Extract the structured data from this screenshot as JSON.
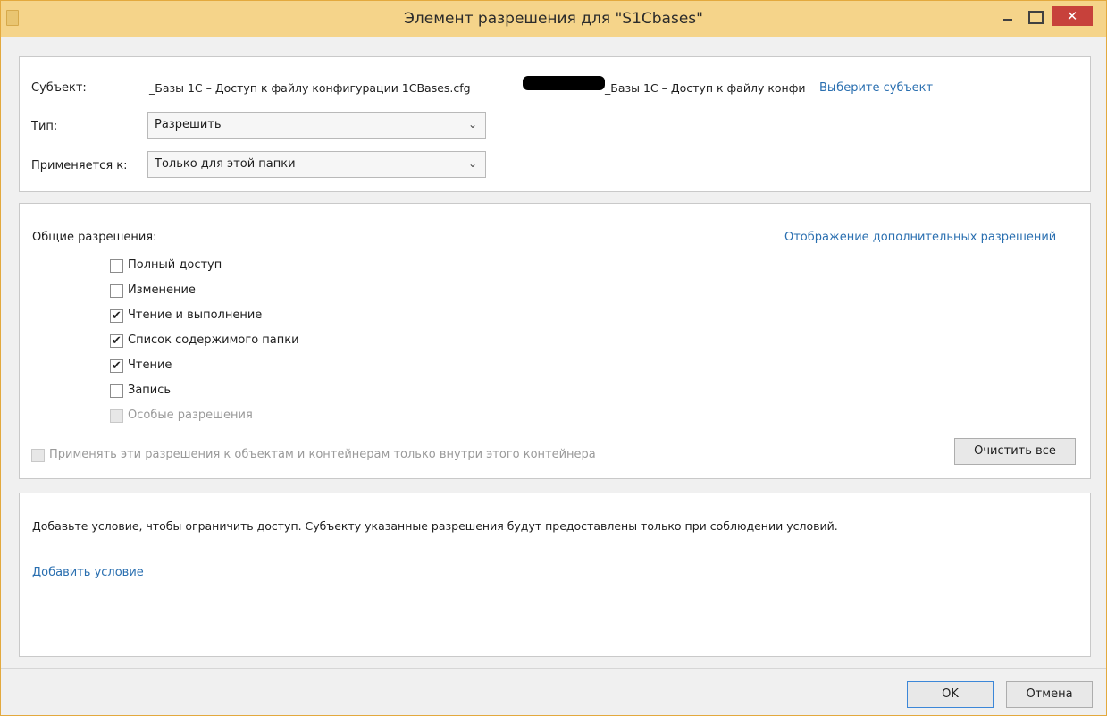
{
  "window": {
    "title": "Элемент разрешения для \"S1Cbases\"",
    "close_glyph": "✕"
  },
  "principal": {
    "label": "Субъект:",
    "value_left": "_Базы 1С – Доступ к файлу конфигурации 1CBases.cfg",
    "value_right": "_Базы 1С – Доступ к файлу конфи",
    "select_link": "Выберите субъект"
  },
  "type": {
    "label": "Тип:",
    "selected": "Разрешить"
  },
  "applies_to": {
    "label": "Применяется к:",
    "selected": "Только для этой папки"
  },
  "permissions": {
    "label": "Общие разрешения:",
    "advanced_link": "Отображение дополнительных разрешений",
    "items": [
      {
        "label": "Полный доступ",
        "checked": false,
        "disabled": false
      },
      {
        "label": "Изменение",
        "checked": false,
        "disabled": false
      },
      {
        "label": "Чтение и выполнение",
        "checked": true,
        "disabled": false
      },
      {
        "label": "Список содержимого папки",
        "checked": true,
        "disabled": false
      },
      {
        "label": "Чтение",
        "checked": true,
        "disabled": false
      },
      {
        "label": "Запись",
        "checked": false,
        "disabled": false
      },
      {
        "label": "Особые разрешения",
        "checked": false,
        "disabled": true
      }
    ],
    "apply_inside_label": "Применять эти разрешения к объектам и контейнерам только внутри этого контейнера",
    "clear_all": "Очистить все"
  },
  "conditions": {
    "text": "Добавьте условие, чтобы ограничить доступ. Субъекту указанные разрешения будут предоставлены только при соблюдении условий.",
    "add_link": "Добавить условие"
  },
  "footer": {
    "ok": "OK",
    "cancel": "Отмена"
  }
}
